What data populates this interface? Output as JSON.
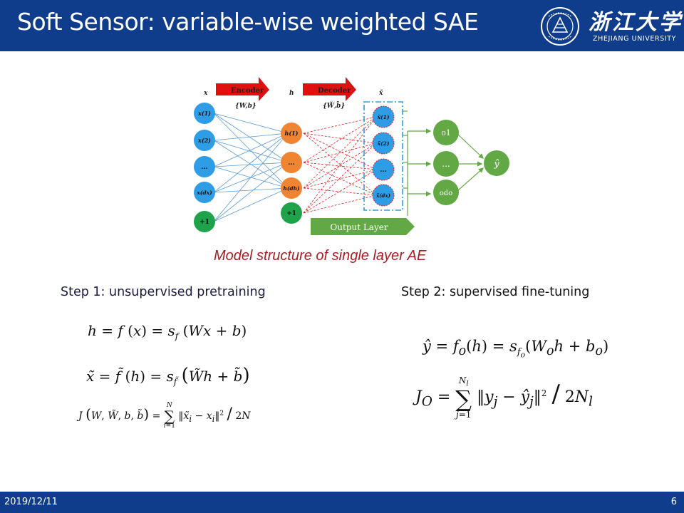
{
  "slide": {
    "title": "Soft Sensor: variable-wise weighted SAE",
    "logo": {
      "chinese_name": "浙江大学",
      "english_name": "ZHEJIANG UNIVERSITY"
    },
    "caption": "Model structure of single layer AE",
    "step1_label": "Step 1: unsupervised pretraining",
    "step2_label": "Step 2: supervised fine-tuning",
    "footer": {
      "date": "2019/12/11",
      "page_number": "6"
    }
  },
  "diagram": {
    "layer_labels": {
      "input": "x",
      "hidden": "h",
      "reconstruction": "x̃"
    },
    "encoder": {
      "label": "Encoder",
      "params": "{W,b}"
    },
    "decoder": {
      "label": "Decoder",
      "params": "{W̃,b̃}"
    },
    "input_nodes": [
      "x(1)",
      "x(2)",
      "...",
      "x(dx)",
      "+1"
    ],
    "hidden_nodes": [
      "h(1)",
      "...",
      "h(dh)",
      "+1"
    ],
    "reconstruction_nodes": [
      "x̃(1)",
      "x̃(2)",
      "...",
      "x̃(dx)"
    ],
    "output_nodes": [
      "o1",
      "...",
      "odo"
    ],
    "final_node": "ŷ",
    "output_layer_label": "Output Layer",
    "colors": {
      "input_node": "#2f9ce6",
      "hidden_node": "#ef8433",
      "bias_node": "#1fa34a",
      "output_node": "#62a845",
      "encoder_arrow": "#e01010",
      "encoder_lines": "#5b9bd5",
      "decoder_lines": "#e02020",
      "header_bar": "#0f3d8c"
    }
  }
}
